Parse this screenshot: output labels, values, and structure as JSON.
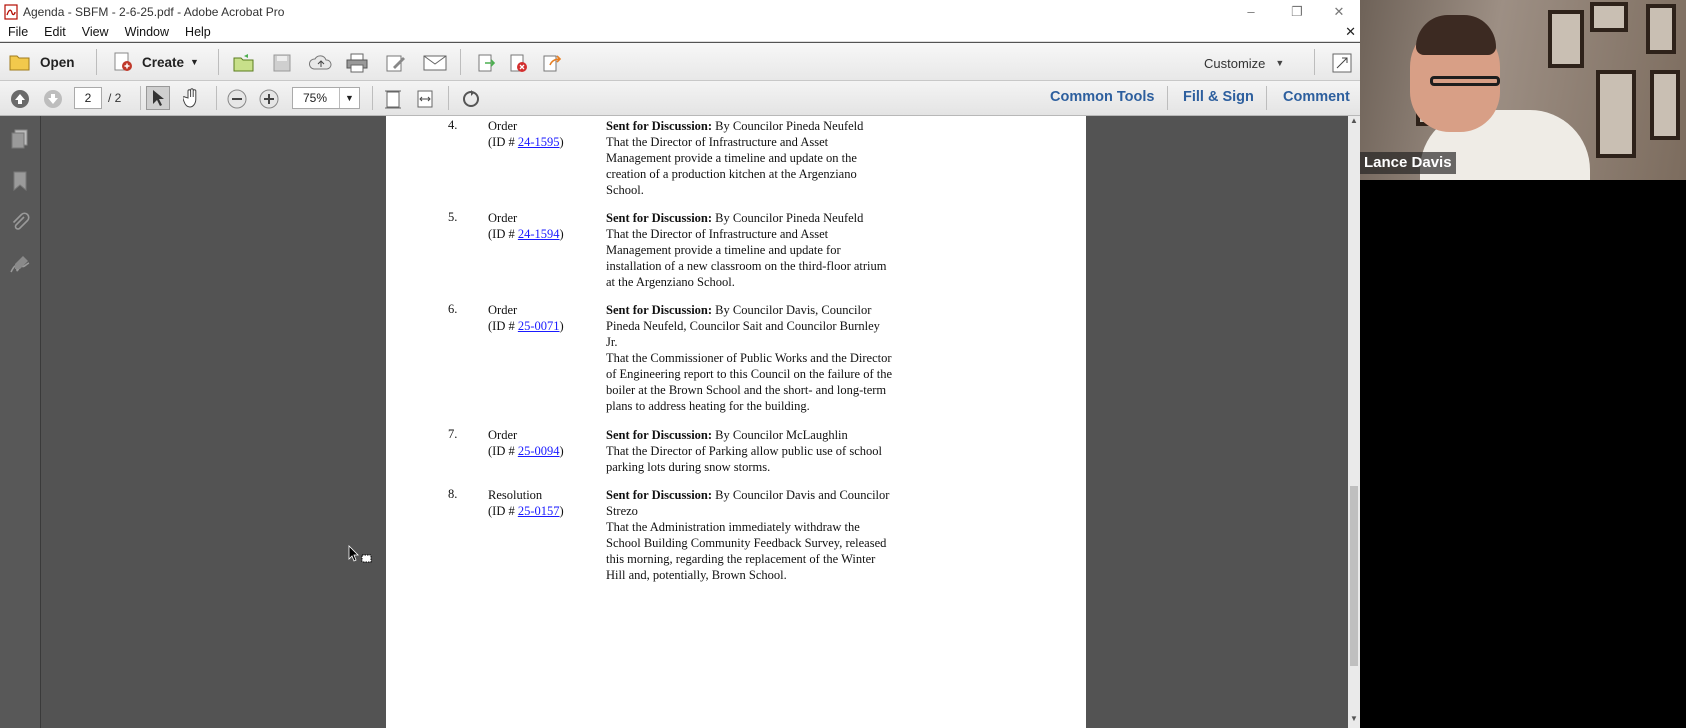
{
  "window": {
    "title": "Agenda - SBFM - 2-6-25.pdf - Adobe Acrobat Pro",
    "minimize": "–",
    "restore": "❐",
    "close": "✕"
  },
  "menubar": {
    "items": [
      "File",
      "Edit",
      "View",
      "Window",
      "Help"
    ],
    "close": "✕"
  },
  "toolbar": {
    "open_label": "Open",
    "create_label": "Create",
    "customize_label": "Customize"
  },
  "nav": {
    "page_current": "2",
    "page_total": "/ 2",
    "zoom": "75%"
  },
  "panels": {
    "common_tools": "Common Tools",
    "fill_sign": "Fill & Sign",
    "comment": "Comment"
  },
  "agenda": [
    {
      "num": "4.",
      "kind": "Order",
      "id_prefix": "(ID # ",
      "id": "24-1595",
      "id_suffix": ")",
      "sent": "Sent for Discussion:",
      "lines": [
        "By Councilor Pineda Neufeld",
        "That the Director of Infrastructure and Asset",
        "Management provide a timeline and update on the",
        "creation of a production kitchen at the Argenziano",
        "School."
      ]
    },
    {
      "num": "5.",
      "kind": "Order",
      "id_prefix": "(ID # ",
      "id": "24-1594",
      "id_suffix": ")",
      "sent": "Sent for Discussion:",
      "lines": [
        "By Councilor Pineda Neufeld",
        "That the Director of Infrastructure and Asset",
        "Management provide a timeline and update for",
        "installation of a new classroom on the third-floor atrium",
        "at the Argenziano School."
      ]
    },
    {
      "num": "6.",
      "kind": "Order",
      "id_prefix": "(ID # ",
      "id": "25-0071",
      "id_suffix": ")",
      "sent": "Sent for Discussion:",
      "lines": [
        "By Councilor Davis, Councilor",
        "Pineda Neufeld, Councilor Sait and Councilor Burnley",
        "Jr.",
        "That the Commissioner of Public Works and the Director",
        "of Engineering report to this Council on the failure of the",
        "boiler at the Brown School and the short- and long-term",
        "plans to address heating for the building."
      ]
    },
    {
      "num": "7.",
      "kind": "Order",
      "id_prefix": "(ID # ",
      "id": "25-0094",
      "id_suffix": ")",
      "sent": "Sent for Discussion:",
      "lines": [
        "By Councilor McLaughlin",
        "That the Director of Parking allow public use of school",
        "parking lots during snow storms."
      ]
    },
    {
      "num": "8.",
      "kind": "Resolution",
      "id_prefix": "(ID # ",
      "id": "25-0157",
      "id_suffix": ")",
      "sent": "Sent for Discussion:",
      "lines": [
        "By Councilor Davis and Councilor",
        "Strezo",
        "That the Administration immediately withdraw the",
        "School Building Community Feedback Survey, released",
        "this morning, regarding the replacement of the Winter",
        "Hill and, potentially, Brown School."
      ]
    }
  ],
  "video": {
    "participant": "Lance Davis"
  },
  "colors": {
    "link": "#1a1aff",
    "panel_link": "#2d5f9e",
    "doc_background": "#535353"
  }
}
